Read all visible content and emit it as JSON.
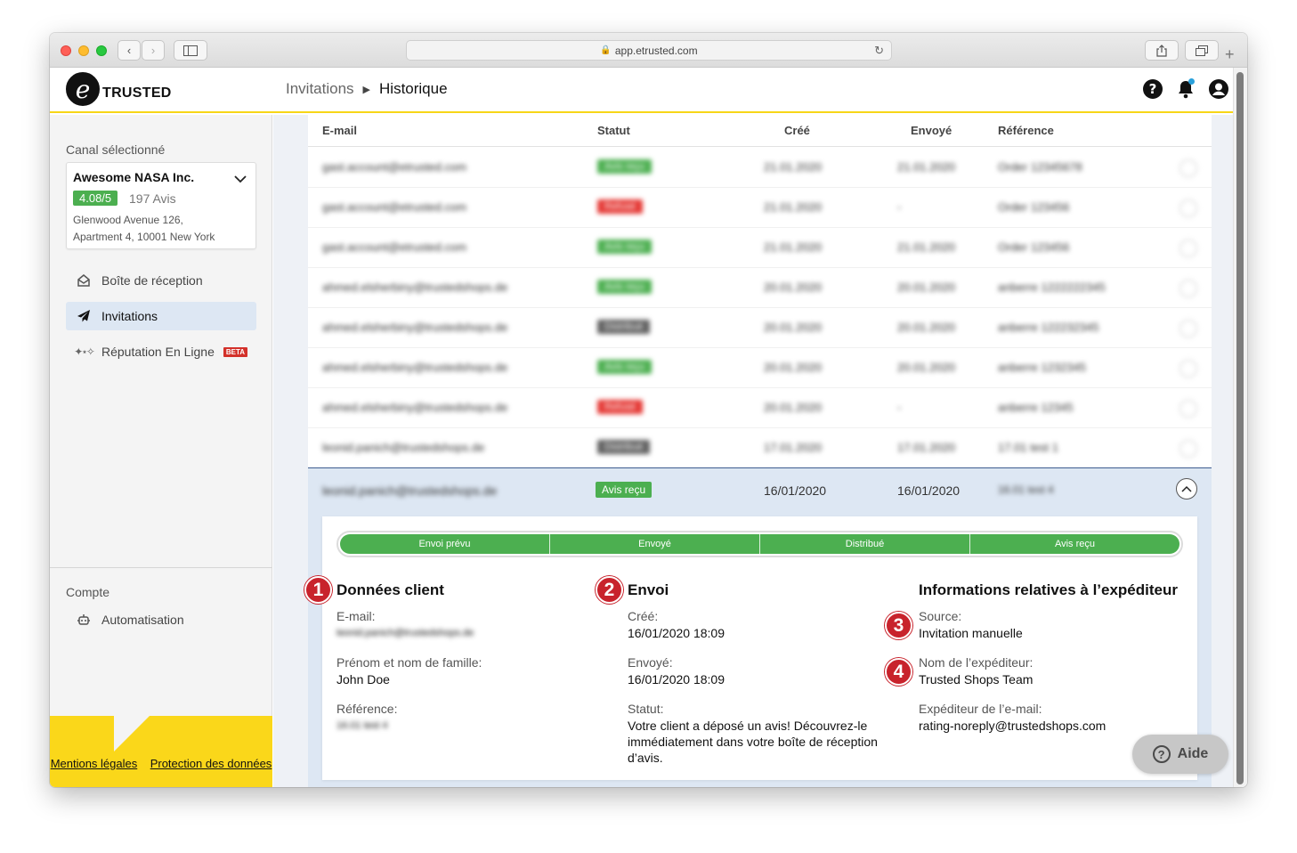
{
  "browser": {
    "url": "app.etrusted.com"
  },
  "header": {
    "logo_letter": "e",
    "logo_text": "TRUSTED",
    "breadcrumb": [
      "Invitations",
      "Historique"
    ]
  },
  "sidebar": {
    "channel_label": "Canal sélectionné",
    "shop": {
      "name": "Awesome NASA Inc.",
      "score": "4.08/5",
      "reviews": "197 Avis",
      "address_line1": "Glenwood Avenue 126,",
      "address_line2": "Apartment 4, 10001 New York"
    },
    "items": [
      {
        "label": "Boîte de réception",
        "icon": "inbox-icon"
      },
      {
        "label": "Invitations",
        "icon": "paper-plane-icon"
      },
      {
        "label": "Réputation En Ligne",
        "icon": "stars-icon",
        "badge": "BETA"
      }
    ],
    "account_label": "Compte",
    "account_items": [
      {
        "label": "Automatisation",
        "icon": "robot-icon"
      }
    ],
    "footer": {
      "legal": "Mentions légales",
      "privacy": "Protection des données"
    }
  },
  "table": {
    "columns": [
      "E-mail",
      "Statut",
      "Créé",
      "Envoyé",
      "Référence"
    ],
    "blurred_rows": [
      {
        "email": "gast.account@etrusted.com",
        "status": "Avis reçu",
        "status_color": "#4caf50",
        "created": "21.01.2020",
        "sent": "21.01.2020",
        "reference": "Order 12345678"
      },
      {
        "email": "gast.account@etrusted.com",
        "status": "Refusé",
        "status_color": "#e53935",
        "created": "21.01.2020",
        "sent": "-",
        "reference": "Order 123456"
      },
      {
        "email": "gast.account@etrusted.com",
        "status": "Avis reçu",
        "status_color": "#4caf50",
        "created": "21.01.2020",
        "sent": "21.01.2020",
        "reference": "Order 123456"
      },
      {
        "email": "ahmed.elsherbiny@trustedshops.de",
        "status": "Avis reçu",
        "status_color": "#4caf50",
        "created": "20.01.2020",
        "sent": "20.01.2020",
        "reference": "anberre 1222222345"
      },
      {
        "email": "ahmed.elsherbiny@trustedshops.de",
        "status": "Distribué",
        "status_color": "#616161",
        "created": "20.01.2020",
        "sent": "20.01.2020",
        "reference": "anberre 122232345"
      },
      {
        "email": "ahmed.elsherbiny@trustedshops.de",
        "status": "Avis reçu",
        "status_color": "#4caf50",
        "created": "20.01.2020",
        "sent": "20.01.2020",
        "reference": "anberre 1232345"
      },
      {
        "email": "ahmed.elsherbiny@trustedshops.de",
        "status": "Refusé",
        "status_color": "#e53935",
        "created": "20.01.2020",
        "sent": "-",
        "reference": "anberre 12345"
      },
      {
        "email": "leonid.panich@trustedshops.de",
        "status": "Distribué",
        "status_color": "#616161",
        "created": "17.01.2020",
        "sent": "17.01.2020",
        "reference": "17.01 test 1"
      }
    ],
    "expanded_row": {
      "email": "leonid.panich@trustedshops.de",
      "status": "Avis reçu",
      "created": "16/01/2020",
      "sent": "16/01/2020",
      "reference": "16.01 test 4"
    }
  },
  "detail": {
    "steps": [
      "Envoi prévu",
      "Envoyé",
      "Distribué",
      "Avis reçu"
    ],
    "customer": {
      "number": "1",
      "title": "Données client",
      "email_label": "E-mail:",
      "email_value": "leonid.panich@trustedshops.de",
      "name_label": "Prénom et nom de famille:",
      "name_value": "John Doe",
      "reference_label": "Référence:",
      "reference_value": "16.01 test 4"
    },
    "sending": {
      "number": "2",
      "title": "Envoi",
      "created_label": "Créé:",
      "created_value": "16/01/2020 18:09",
      "sent_label": "Envoyé:",
      "sent_value": "16/01/2020 18:09",
      "status_label": "Statut:",
      "status_value": "Votre client a déposé un avis! Découvrez-le immédiatement dans votre boîte de réception d’avis."
    },
    "sender": {
      "title": "Informations relatives à l’expéditeur",
      "source_number": "3",
      "source_label": "Source:",
      "source_value": "Invitation manuelle",
      "name_number": "4",
      "name_label": "Nom de l’expéditeur:",
      "name_value": "Trusted Shops Team",
      "email_label": "Expéditeur de l’e-mail:",
      "email_value": "rating-noreply@trustedshops.com"
    }
  },
  "help_button": "Aide"
}
